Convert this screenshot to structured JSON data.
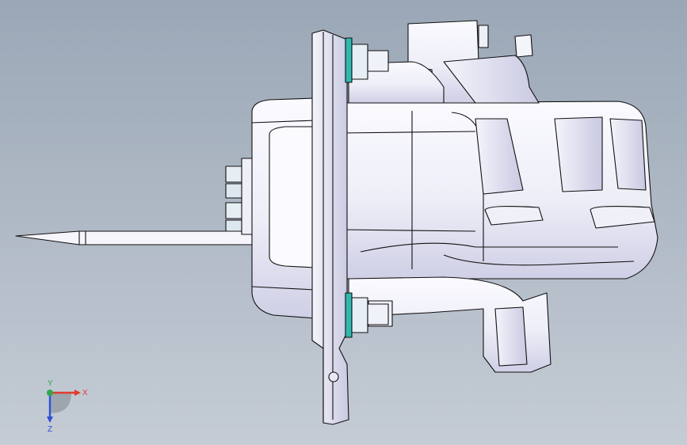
{
  "viewport": {
    "background_top": "#9aa7b6",
    "background_bottom": "#c5ccd5",
    "model_fill": "#f3f3fa",
    "model_shade": "#d8d8ec",
    "model_edge": "#111111",
    "highlight_color": "#2fb8b0"
  },
  "triad": {
    "x_label": "X",
    "y_label": "Y",
    "z_label": "Z",
    "x_color": "#e23c2c",
    "y_color": "#2ea84a",
    "z_color": "#2f4fd8"
  }
}
